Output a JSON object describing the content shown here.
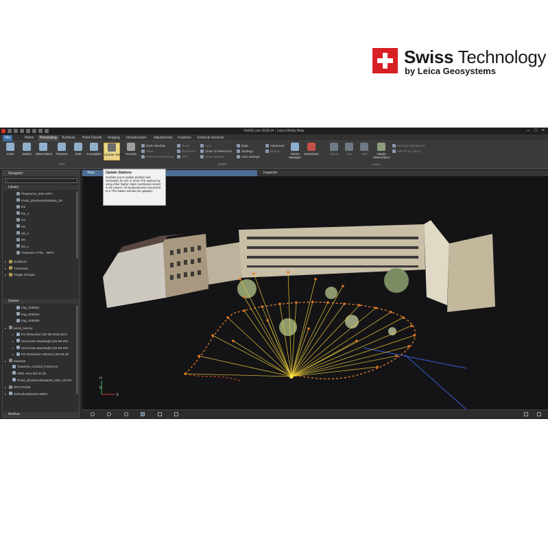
{
  "brand": {
    "title_bold": "Swiss",
    "title_rest": " Technology",
    "subtitle": "by Leica Geosystems",
    "flag_color": "#d91f26"
  },
  "window": {
    "title": "HxGN Live 2018 v4 - Leica Infinity Beta"
  },
  "menu_tabs": [
    "File",
    "Home",
    "Processing",
    "Surfaces",
    "Point Clouds",
    "Imaging",
    "Infrastructure",
    "Adjustments",
    "Features",
    "External Services"
  ],
  "ribbon": {
    "tps_buttons": [
      "Point",
      "Station",
      "Observation",
      "Traverse",
      "Sets",
      "Foresights",
      "Update Stations",
      "Process"
    ],
    "tps_group": "TPS",
    "gnss_small": [
      "NOS Absolute",
      "Store",
      "Remove Processing"
    ],
    "gnss_small2": [
      "Rover",
      "Reference",
      "SPP"
    ],
    "gnss_small3": [
      "Auto",
      "Clear All Selections",
      "Clear Window"
    ],
    "gnss_small4": [
      "Data",
      "Strategy",
      "Auto Settings"
    ],
    "gnss_small5": [
      "Advanced",
      "Report"
    ],
    "gnss_buttons": [
      "GNSS Manager",
      "Download"
    ],
    "gnss_group": "GNSS",
    "level_buttons": [
      "Adjust",
      "Join",
      "Split",
      "Height Observation"
    ],
    "level_small": [
      "Remove Adjustment",
      "Add TP to Library"
    ],
    "level_group": "Level"
  },
  "tooltip": {
    "title": "Update Stations",
    "body": "Enables you to update position and orientation for one or more TPS stations by using other higher class coordinates stored in the project. All measurements connected to a TPS station will also be updated."
  },
  "navigator": {
    "title": "Navigator",
    "search_placeholder": "",
    "library_label": "Library",
    "library_items": [
      "Phantom4_40m-DPC",
      "Pond_phantom4Dataset_20",
      "R2",
      "R2_1",
      "S4",
      "S5",
      "S5_1",
      "S6",
      "S6_1",
      "Traverse CTRL - WFS"
    ],
    "library_groups": [
      "Surfaces",
      "Traverses",
      "Image Groups"
    ],
    "source_label": "Source",
    "source_items": [
      "img_000081",
      "img_000082",
      "img_000083",
      "pond_survey",
      "R1 Resection (30-08-2018 00:0",
      "S5 Known Backsight (30-08-201",
      "S6 Known Backsight (30-08-201",
      "R2 Resection Helmert (30-08-20",
      "traverse",
      "Traverse_Control_Points.txt",
      "HBG reno bld 4A.ifc",
      "Pond_phantom4Dataset_40m_GCPs",
      "RTK-Points",
      "DefaultJobName-WDN"
    ],
    "archive_label": "Archive"
  },
  "viewer": {
    "tab_view": "View",
    "tab_inspector": "Inspector",
    "axis_n": "N",
    "axis_h": "H",
    "axis_e": "E"
  },
  "colors": {
    "accent": "#4b6d94",
    "highlight": "#e8d58a",
    "ray": "#f2d13a",
    "point": "#e07a2a",
    "blue_line": "#3b5fd9"
  }
}
